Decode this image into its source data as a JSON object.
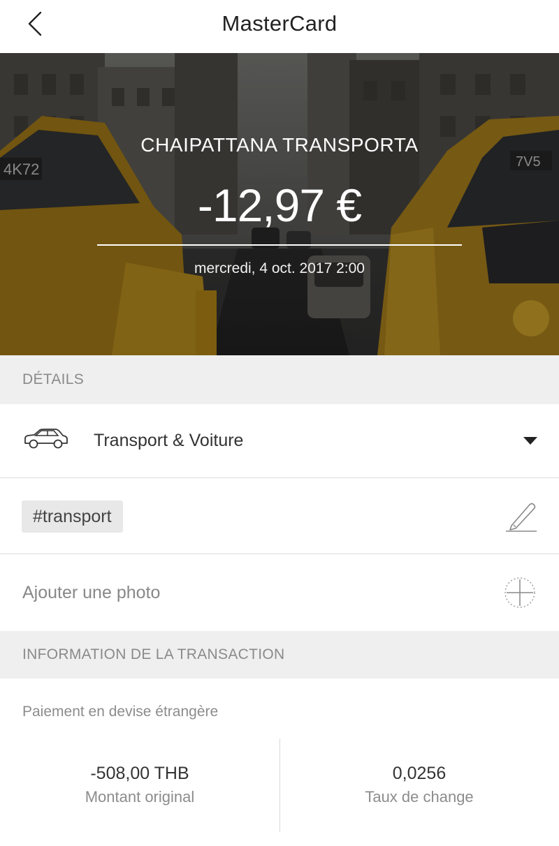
{
  "header": {
    "title": "MasterCard",
    "back_icon": "chevron-left-icon"
  },
  "transaction": {
    "merchant": "CHAIPATTANA TRANSPORTA",
    "amount": "-12,97 €",
    "date": "mercredi, 4 oct. 2017 2:00"
  },
  "details": {
    "section_title": "DÉTAILS",
    "category": {
      "icon": "car-icon",
      "label": "Transport & Voiture"
    },
    "tag": "#transport",
    "add_photo_label": "Ajouter une photo"
  },
  "info": {
    "section_title": "INFORMATION DE LA TRANSACTION",
    "foreign_payment_label": "Paiement en devise étrangère",
    "original_amount": {
      "value": "-508,00 THB",
      "caption": "Montant original"
    },
    "exchange_rate": {
      "value": "0,0256",
      "caption": "Taux de change"
    }
  },
  "colors": {
    "section_bg": "#efefef",
    "taxi_yellow": "#c89a1e",
    "text_muted": "#8a8a8a"
  }
}
